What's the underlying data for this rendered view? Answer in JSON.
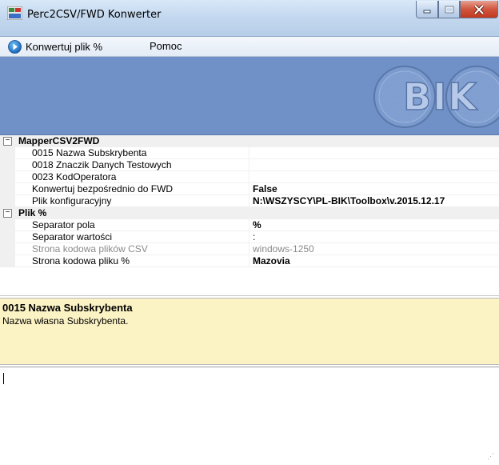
{
  "window": {
    "title": "Perc2CSV/FWD Konwerter"
  },
  "menu": {
    "convert_label": "Konwertuj plik %",
    "help_label": "Pomoc"
  },
  "banner": {
    "logo_text": "BIK",
    "background_color": "#6f91c8"
  },
  "propgrid": {
    "categories": [
      {
        "label": "MapperCSV2FWD",
        "expanded": true,
        "properties": [
          {
            "name": "0015 Nazwa Subskrybenta",
            "value": ""
          },
          {
            "name": "0018 Znaczik Danych Testowych",
            "value": ""
          },
          {
            "name": "0023 KodOperatora",
            "value": ""
          },
          {
            "name": "Konwertuj bezpośrednio do FWD",
            "value": "False"
          },
          {
            "name": "Plik konfiguracyjny",
            "value": "N:\\WSZYSCY\\PL-BIK\\Toolbox\\v.2015.12.17"
          }
        ]
      },
      {
        "label": "Plik %",
        "expanded": true,
        "properties": [
          {
            "name": "Separator pola",
            "value": "%"
          },
          {
            "name": "Separator wartości",
            "value": ":"
          },
          {
            "name": "Strona kodowa plików CSV",
            "value": "windows-1250"
          },
          {
            "name": "Strona kodowa pliku %",
            "value": "Mazovia"
          }
        ]
      }
    ]
  },
  "help": {
    "title": "0015 Nazwa Subskrybenta",
    "description": "Nazwa własna Subskrybenta.",
    "background_color": "#fcf3c5"
  },
  "log": {
    "value": ""
  }
}
